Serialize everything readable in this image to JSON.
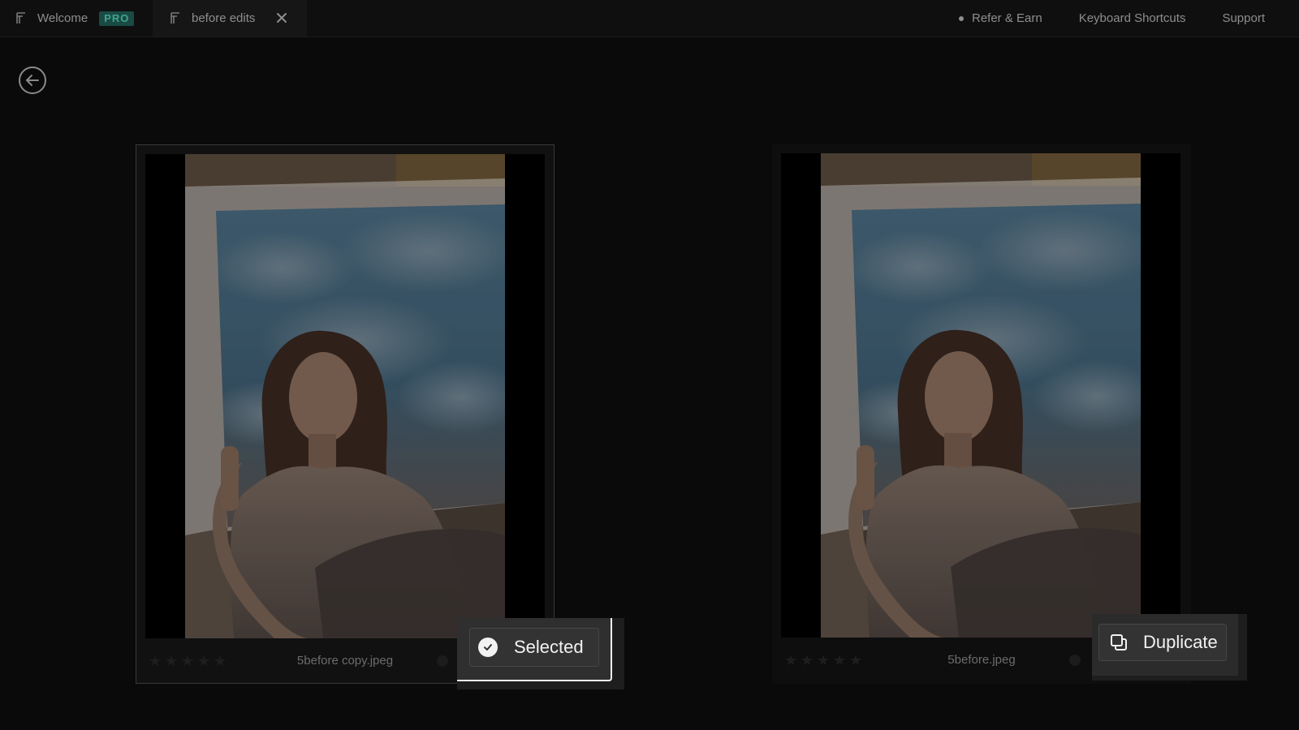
{
  "tabs": [
    {
      "label": "Welcome",
      "badge": "PRO"
    },
    {
      "label": "before edits"
    }
  ],
  "nav": {
    "refer": "Refer & Earn",
    "shortcuts": "Keyboard Shortcuts",
    "support": "Support"
  },
  "images": [
    {
      "filename": "5before copy.jpeg",
      "rating": 0,
      "selected": true
    },
    {
      "filename": "5before.jpeg",
      "rating": 0,
      "selected": false
    }
  ],
  "actions": {
    "selected_label": "Selected",
    "duplicate_label": "Duplicate"
  },
  "icons": {
    "back": "arrow-left-circle-icon",
    "close": "close-icon",
    "check": "check-circle-icon",
    "duplicate": "duplicate-icon",
    "star": "star-icon",
    "logo": "app-logo-icon"
  },
  "colors": {
    "background": "#0a0a0a",
    "pro_badge": "#1a4a44",
    "pro_text": "#3ea58f",
    "selected_outline": "#f2f2f2"
  }
}
